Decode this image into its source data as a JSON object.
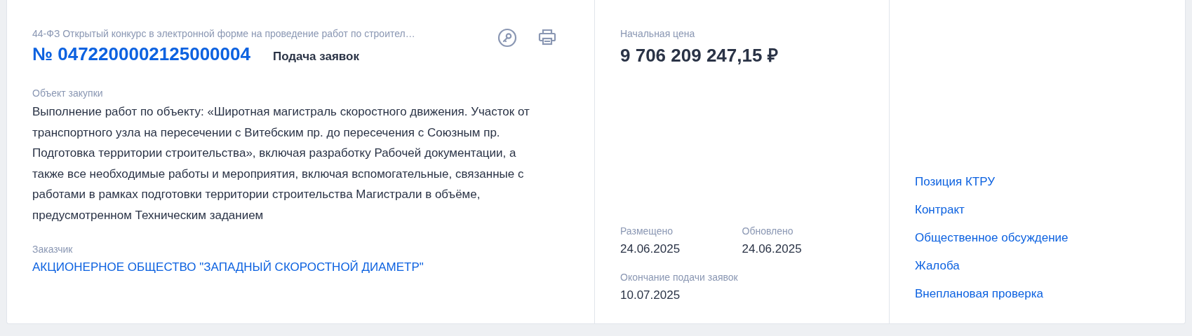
{
  "procurement": {
    "type_line": "44-ФЗ Открытый конкурс в электронной форме на проведение работ по строител…",
    "number": "№ 0472200002125000004",
    "stage": "Подача заявок",
    "object_label": "Объект закупки",
    "object_text": "Выполнение работ по объекту: «Широтная магистраль скоростного движения. Участок от транспортного узла на пересечении с Витебским пр. до пересечения с Союзным пр. Подготовка территории строительства», включая разработку Рабочей документации, а также все необходимые работы и мероприятия, включая вспомогательные, связанные с работами в рамках подготовки территории строительства Магистрали в объёме, предусмотренном Техническим заданием",
    "customer_label": "Заказчик",
    "customer": "АКЦИОНЕРНОЕ ОБЩЕСТВО \"ЗАПАДНЫЙ СКОРОСТНОЙ ДИАМЕТР\""
  },
  "price": {
    "label": "Начальная цена",
    "value": "9 706 209 247,15 ₽"
  },
  "dates": [
    {
      "label": "Размещено",
      "value": "24.06.2025"
    },
    {
      "label": "Обновлено",
      "value": "24.06.2025"
    }
  ],
  "deadline": {
    "label": "Окончание подачи заявок",
    "value": "10.07.2025"
  },
  "links": [
    "Позиция КТРУ",
    "Контракт",
    "Общественное обсуждение",
    "Жалоба",
    "Внеплановая проверка"
  ]
}
